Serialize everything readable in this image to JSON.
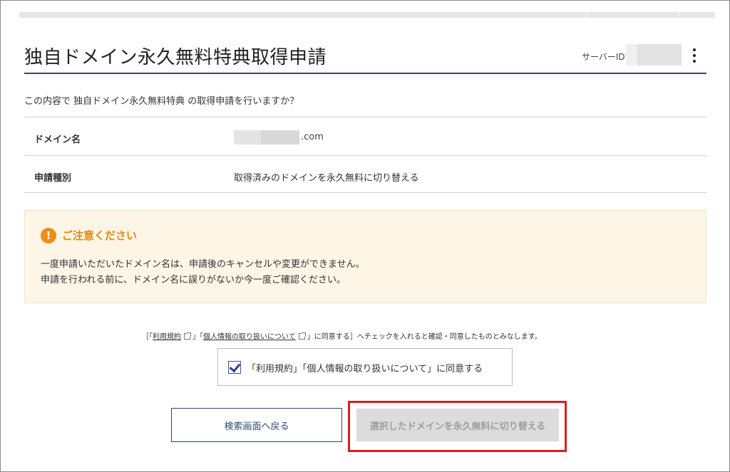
{
  "page": {
    "title": "独自ドメイン永久無料特典取得申請",
    "server_id_label": "サーバーID",
    "confirm_text": "この内容で 独自ドメイン永久無料特典 の取得申請を行いますか？"
  },
  "info_table": {
    "rows": [
      {
        "label": "ドメイン名",
        "value": ".com"
      },
      {
        "label": "申請種別",
        "value": "取得済みのドメインを永久無料に切り替える"
      }
    ]
  },
  "caution": {
    "icon_glyph": "!",
    "title": "ご注意ください",
    "line1": "一度申請いただいたドメイン名は、申請後のキャンセルや変更ができません。",
    "line2": "申請を行われる前に、ドメイン名に誤りがないか今一度ご確認ください。"
  },
  "agreement": {
    "bracket_open": "［「",
    "terms_link": "利用規約",
    "mid": "」「",
    "privacy_link": "個人情報の取り扱いについて",
    "tail": "」に同意する］へチェックを入れると確認・同意したものとみなします。",
    "checkbox_label": "「利用規約」「個人情報の取り扱いについて」に同意する",
    "checked": true
  },
  "buttons": {
    "back": "検索画面へ戻る",
    "submit": "選択したドメインを永久無料に切り替える"
  },
  "colors": {
    "accent_navy": "#2c4a6e",
    "caution_orange": "#f08c1a",
    "highlight_red": "#d81f1f",
    "caution_bg": "#fdf5e6"
  },
  "icons": [
    "kebab-menu-icon",
    "exclamation-icon",
    "external-link-icon",
    "checkmark-icon"
  ]
}
